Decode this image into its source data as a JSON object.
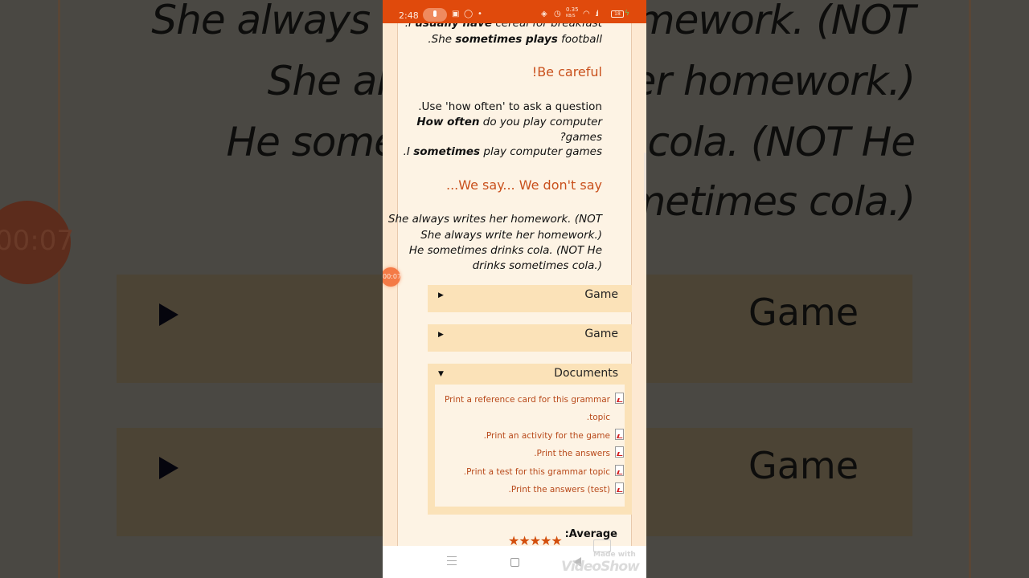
{
  "background": {
    "lines": [
      "She always writes her homework. (NOT",
      "She always write her homework.)",
      "He sometimes drinks cola. (NOT He",
      "drinks sometimes cola.)"
    ],
    "game_label": "Game",
    "timer": "00:07"
  },
  "statusbar": {
    "time": "2:48",
    "net_speed": "0.35",
    "net_unit": "KB/S",
    "battery": "18"
  },
  "content": {
    "top_lines": [
      {
        "pre": ".I ",
        "bold": "usually have",
        "post": " cereal for breakfast"
      },
      {
        "pre": ".She ",
        "bold": "sometimes plays",
        "post": " football"
      }
    ],
    "be_careful": {
      "heading": "!Be careful",
      "intro": ".Use 'how often' to ask a question",
      "example_q_bold": "How often",
      "example_q_rest": " do you play computer",
      "example_q_wrap": "?games",
      "example_a_pre": ".I ",
      "example_a_bold": "sometimes",
      "example_a_rest": " play computer games"
    },
    "we_say": {
      "heading": "...We say... We don't say",
      "lines": [
        "She always writes her homework. (NOT",
        "She always write her homework.)",
        "He sometimes drinks cola. (NOT He",
        "drinks sometimes cola.)"
      ]
    },
    "accordions": [
      {
        "label": "Game",
        "expanded": false
      },
      {
        "label": "Game",
        "expanded": false
      },
      {
        "label": "Documents",
        "expanded": true
      }
    ],
    "documents": [
      "Print a reference card for this grammar",
      ".topic",
      ".Print an activity for the game",
      ".Print the answers",
      ".Print a test for this grammar topic",
      ".Print the answers (test)"
    ],
    "rating": {
      "label": ":Average",
      "stars": "★★★★★",
      "value": 5,
      "max": 5
    }
  },
  "overlay": {
    "timer": "00:07",
    "watermark_made": "Made with",
    "watermark_brand": "VideoShow"
  },
  "colors": {
    "statusbar": "#e04a0c",
    "heading": "#c9501c",
    "link": "#b8491a",
    "accordion": "#fbe2b8",
    "page": "#fdf3e4",
    "stars": "#d34e0c"
  }
}
